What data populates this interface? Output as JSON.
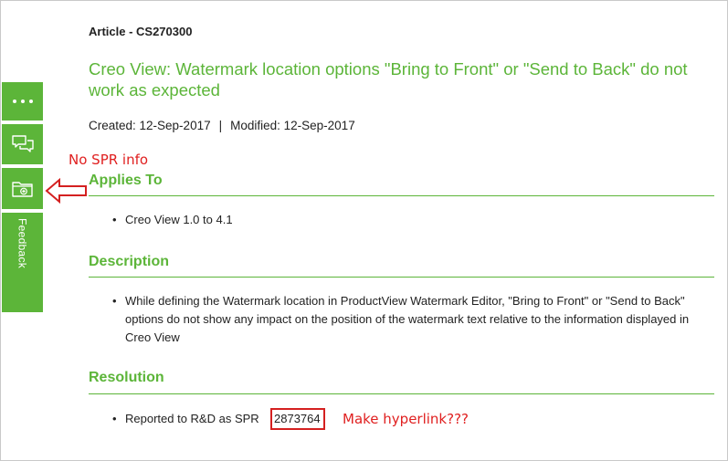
{
  "article": {
    "id_label": "Article - CS270300",
    "title": "Creo View: Watermark location options \"Bring to Front\" or \"Send to Back\" do not work as expected",
    "created": "Created: 12-Sep-2017",
    "separator": "|",
    "modified": "Modified: 12-Sep-2017"
  },
  "sections": {
    "applies_to": {
      "heading": "Applies To",
      "bullets": [
        "Creo View 1.0 to 4.1"
      ]
    },
    "description": {
      "heading": "Description",
      "bullets": [
        "While defining the Watermark location in ProductView Watermark Editor, \"Bring to Front\" or \"Send to Back\" options do not show any impact on the position of the watermark text relative to the information displayed in Creo View"
      ]
    },
    "resolution": {
      "heading": "Resolution",
      "bullet_prefix": "Reported to R&D as SPR",
      "spr_number": "2873764"
    }
  },
  "rail": {
    "more_icon": "more-dots-icon",
    "chat_icon": "chat-bubbles-icon",
    "folder_icon": "folder-add-icon",
    "feedback_label": "Feedback",
    "color": "#5cb539"
  },
  "annotations": {
    "no_spr": "No SPR info",
    "make_hyperlink": "Make hyperlink???",
    "color": "#e02020"
  },
  "bullet_char": "•"
}
